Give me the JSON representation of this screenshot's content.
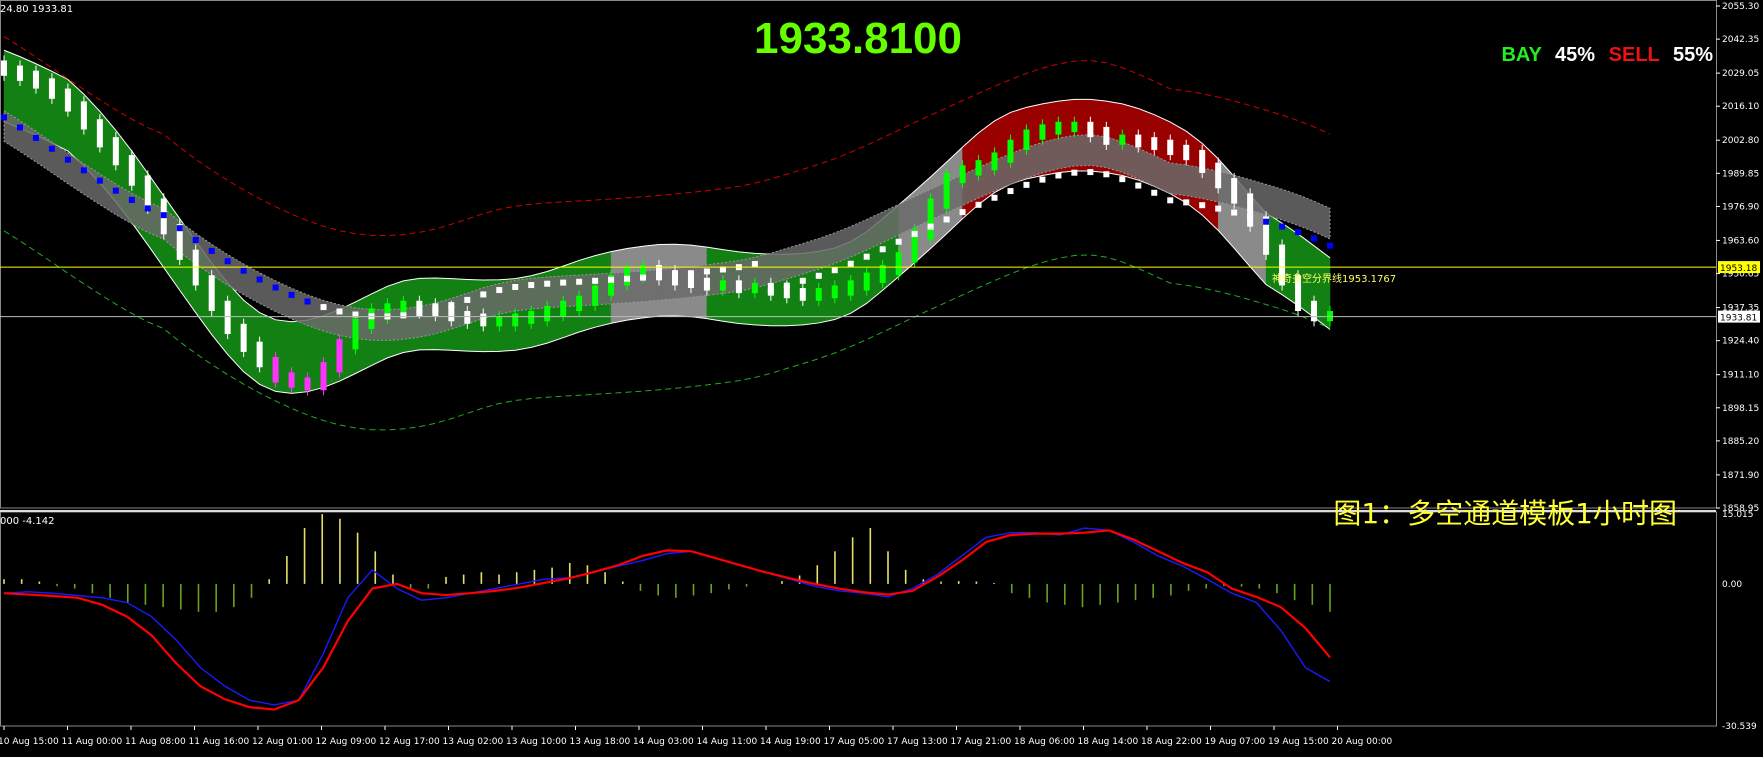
{
  "header": {
    "price_top_left": "24.80 1933.81",
    "big_price": "1933.8100",
    "bay_label": "BAY",
    "bay_pct": "45%",
    "sell_label": "SELL",
    "sell_pct": "55%",
    "caption": "图1：多空通道模板1小时图",
    "divider_label": "神奇多空分界线1953.1767",
    "macd_label": "000 -4.142",
    "price_tag_yellow": "1953.18",
    "price_tag_white": "1933.81"
  },
  "colors": {
    "background": "#000000",
    "bull_candle": "#00ff00",
    "bear_candle": "#ffffff",
    "magenta_candle": "#ff33ff",
    "blue_band": "#0000ff",
    "channel_green": "#128012",
    "channel_red": "#990000",
    "channel_gray": "#8a8a8a",
    "divider_line": "#ffff00",
    "macd_signal": "#ff0000",
    "macd_line": "#1a1aff"
  },
  "chart_data": [
    {
      "type": "line",
      "name": "price",
      "ylim": [
        1858.95,
        2055.3
      ],
      "y_tick_labels": [
        "2055.30",
        "2042.35",
        "2029.05",
        "2016.10",
        "2002.80",
        "1989.85",
        "1976.90",
        "1963.60",
        "1950.65",
        "1937.35",
        "1924.40",
        "1911.10",
        "1898.15",
        "1885.20",
        "1871.90",
        "1858.95"
      ],
      "x_tick_labels": [
        "10 Aug 15:00",
        "11 Aug 00:00",
        "11 Aug 08:00",
        "11 Aug 16:00",
        "12 Aug 01:00",
        "12 Aug 09:00",
        "12 Aug 17:00",
        "13 Aug 02:00",
        "13 Aug 10:00",
        "13 Aug 18:00",
        "14 Aug 03:00",
        "14 Aug 11:00",
        "14 Aug 19:00",
        "17 Aug 05:00",
        "17 Aug 13:00",
        "17 Aug 21:00",
        "18 Aug 06:00",
        "18 Aug 14:00",
        "18 Aug 22:00",
        "19 Aug 07:00",
        "19 Aug 15:00",
        "20 Aug 00:00"
      ],
      "close": [
        2030,
        2028,
        2025,
        2021,
        2016,
        2009,
        2002,
        1995,
        1987,
        1978,
        1968,
        1958,
        1948,
        1938,
        1929,
        1922,
        1916,
        1910,
        1908,
        1907,
        1914,
        1923,
        1931,
        1935,
        1937,
        1938,
        1937,
        1936,
        1934,
        1933,
        1932,
        1932,
        1933,
        1934,
        1936,
        1938,
        1940,
        1944,
        1948,
        1951,
        1952,
        1950,
        1948,
        1947,
        1946,
        1946,
        1945,
        1945,
        1944,
        1943,
        1942,
        1943,
        1944,
        1946,
        1949,
        1952,
        1957,
        1966,
        1978,
        1988,
        1991,
        1993,
        1996,
        2001,
        2005,
        2007,
        2008,
        2008,
        2006,
        2003,
        2003,
        2002,
        2001,
        1999,
        1997,
        1992,
        1986,
        1980,
        1971,
        1960,
        1948,
        1938,
        1934,
        1934
      ],
      "divider_level": 1953.18,
      "last_price": 1933.81
    },
    {
      "type": "bar",
      "name": "macd",
      "ylim": [
        -30.539,
        15.015
      ],
      "y_tick_labels": [
        "15.015",
        "0.00",
        "-30.539"
      ],
      "histogram": [
        1,
        1,
        0.5,
        -0.5,
        -1,
        -2,
        -3,
        -4,
        -4.5,
        -5,
        -5.5,
        -6,
        -6,
        -5,
        -3,
        1,
        6,
        12,
        15,
        14,
        11,
        7,
        2,
        -1,
        -1,
        1.5,
        2,
        2.5,
        2,
        2.5,
        3,
        3.5,
        4.5,
        4,
        2.5,
        0.5,
        -1.5,
        -2.5,
        -3,
        -2.5,
        -2,
        -1.2,
        -0.6,
        0,
        0.6,
        1.8,
        4,
        7,
        10,
        12,
        7,
        3,
        1,
        0.5,
        0.6,
        0.5,
        0.2,
        -2,
        -3,
        -4,
        -4.5,
        -5,
        -4.5,
        -4,
        -3.5,
        -3,
        -2.5,
        -1.5,
        -1,
        -0.5,
        -0.6,
        -1,
        -2,
        -3.5,
        -4.5,
        -6
      ],
      "main": [
        -2,
        -1.7,
        -2,
        -2.5,
        -3,
        -4,
        -7,
        -12,
        -18,
        -22,
        -25,
        -26,
        -25,
        -15,
        -3,
        3,
        -1,
        -3.5,
        -3,
        -2,
        -1,
        0,
        1,
        1.3,
        2.5,
        3.8,
        5,
        6.5,
        7,
        5.5,
        4,
        2.5,
        1,
        -0.5,
        -1.5,
        -2,
        -2.8,
        -1,
        2,
        6,
        10,
        11,
        11,
        10.5,
        12,
        11.5,
        9,
        6,
        3.8,
        1,
        -2,
        -4,
        -10,
        -18,
        -21
      ],
      "signal": [
        -2,
        -2.3,
        -2.6,
        -3,
        -4.5,
        -7,
        -11,
        -17,
        -22,
        -24.8,
        -26.5,
        -27,
        -25,
        -18,
        -8,
        -1,
        0,
        -2,
        -2.4,
        -2,
        -1.5,
        -0.8,
        0.2,
        1.2,
        2.5,
        4,
        6,
        7.2,
        7,
        5.5,
        4,
        2.5,
        1.2,
        0,
        -1,
        -1.8,
        -2.3,
        -1.5,
        1.5,
        5,
        9,
        10.5,
        10.8,
        10.8,
        11,
        11.5,
        9.5,
        7,
        4.5,
        2.5,
        -1,
        -2.8,
        -5,
        -9.5,
        -15.8
      ]
    }
  ]
}
